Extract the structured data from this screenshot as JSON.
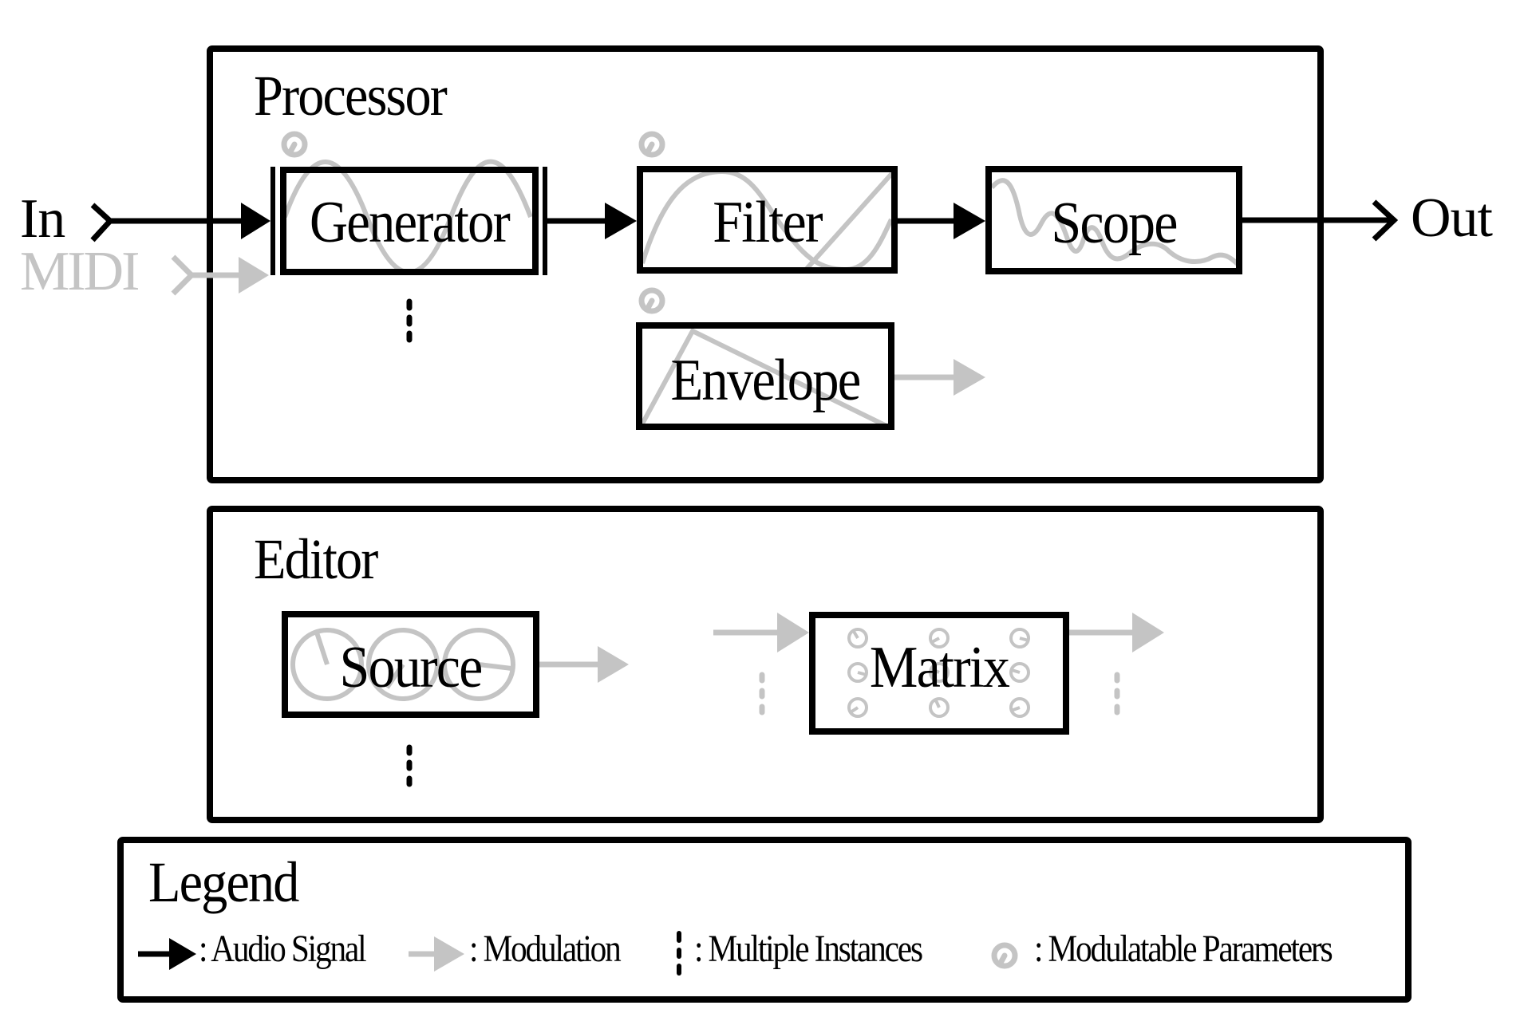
{
  "diagram": {
    "colors": {
      "audio": "#000000",
      "modulation": "#c4c4c4",
      "background": "#ffffff"
    },
    "io": {
      "input_label": "In",
      "midi_label": "MIDI",
      "output_label": "Out"
    },
    "processor": {
      "title": "Processor",
      "modules": [
        {
          "id": "generator",
          "label": "Generator",
          "glyph": "sine-wave",
          "modulatable": true,
          "multiple_instances": true
        },
        {
          "id": "filter",
          "label": "Filter",
          "glyph": "filter-curve",
          "modulatable": true,
          "multiple_instances": false
        },
        {
          "id": "scope",
          "label": "Scope",
          "glyph": "oscilloscope-trace",
          "modulatable": false,
          "multiple_instances": false
        },
        {
          "id": "envelope",
          "label": "Envelope",
          "glyph": "envelope-triangle",
          "modulatable": true,
          "multiple_instances": false
        }
      ]
    },
    "editor": {
      "title": "Editor",
      "modules": [
        {
          "id": "source",
          "label": "Source",
          "glyph": "three-knob-dials",
          "multiple_instances": true
        },
        {
          "id": "matrix",
          "label": "Matrix",
          "glyph": "knob-grid-3x3",
          "multiple_instances": true
        }
      ]
    },
    "connections": [
      {
        "from": "In",
        "to": "Generator",
        "type": "audio"
      },
      {
        "from": "MIDI",
        "to": "Generator",
        "type": "modulation"
      },
      {
        "from": "Generator",
        "to": "Filter",
        "type": "audio"
      },
      {
        "from": "Filter",
        "to": "Scope",
        "type": "audio"
      },
      {
        "from": "Scope",
        "to": "Out",
        "type": "audio"
      },
      {
        "from": "Envelope",
        "to": "(out)",
        "type": "modulation"
      },
      {
        "from": "Source",
        "to": "(out)",
        "type": "modulation"
      },
      {
        "from": "(in)",
        "to": "Matrix",
        "type": "modulation"
      },
      {
        "from": "Matrix",
        "to": "(out)",
        "type": "modulation"
      }
    ],
    "legend": {
      "title": "Legend",
      "items": [
        {
          "icon": "black-arrow-icon",
          "label": ": Audio Signal"
        },
        {
          "icon": "gray-arrow-icon",
          "label": ": Modulation"
        },
        {
          "icon": "vertical-dots-icon",
          "label": ": Multiple Instances"
        },
        {
          "icon": "knob-icon",
          "label": ": Modulatable Parameters"
        }
      ]
    }
  }
}
